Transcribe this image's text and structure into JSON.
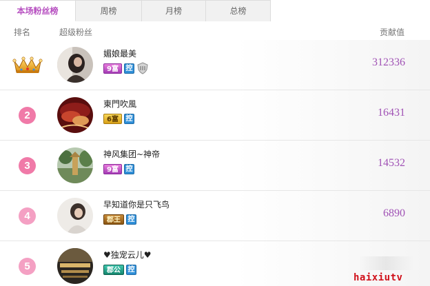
{
  "tabs": [
    {
      "label": "本场粉丝榜",
      "active": true
    },
    {
      "label": "周榜",
      "active": false
    },
    {
      "label": "月榜",
      "active": false
    },
    {
      "label": "总榜",
      "active": false
    }
  ],
  "columns": {
    "rank": "排名",
    "fans": "超级粉丝",
    "value": "贡献值"
  },
  "rows": [
    {
      "rank": "1",
      "rank_icon": "crown-icon",
      "name": "媚娘最美",
      "badge": "9富",
      "badge_style": "purple",
      "control": "控",
      "extra_icon": "shield-icon",
      "value": "312336"
    },
    {
      "rank": "2",
      "name": "東門吹風",
      "badge": "6富",
      "badge_style": "gold",
      "control": "控",
      "value": "16431"
    },
    {
      "rank": "3",
      "name": "神风集团~神帝",
      "badge": "9富",
      "badge_style": "purple",
      "control": "控",
      "value": "14532"
    },
    {
      "rank": "4",
      "name": "早知道你是只飞鸟",
      "badge": "郡王",
      "badge_style": "brown",
      "control": "控",
      "value": "6890"
    },
    {
      "rank": "5",
      "name": "♥独宠云儿♥",
      "badge": "郡公",
      "badge_style": "teal",
      "control": "控",
      "value": ""
    }
  ],
  "watermark": "haixiutv",
  "colors": {
    "accent": "#b64fc0",
    "value": "#a052b5",
    "rank_circle": "#f07aa8"
  }
}
